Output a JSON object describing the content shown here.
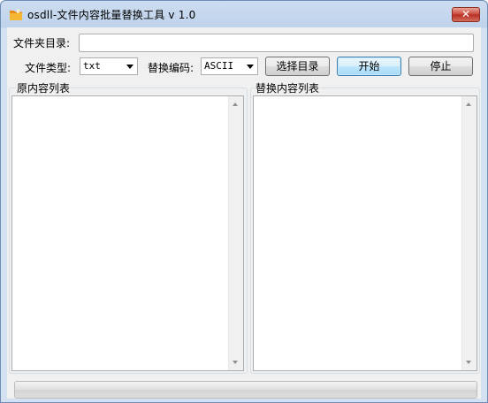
{
  "window": {
    "title": "osdll-文件内容批量替换工具 v 1.0",
    "close_glyph": "✕",
    "icon": "folder-icon"
  },
  "form": {
    "folder_label": "文件夹目录:",
    "folder_value": "",
    "filetype_label": "文件类型:",
    "filetype_value": "txt",
    "encoding_label": "替换编码:",
    "encoding_value": "ASCII"
  },
  "buttons": {
    "choose_dir": "选择目录",
    "start": "开始",
    "stop": "停止"
  },
  "panels": {
    "original_title": "原内容列表",
    "replaced_title": "替换内容列表"
  },
  "progress": {
    "fraction": 0
  },
  "colors": {
    "icon_yellow": "#f6b733",
    "icon_orange": "#e98a17",
    "close_red": "#c8453a"
  }
}
